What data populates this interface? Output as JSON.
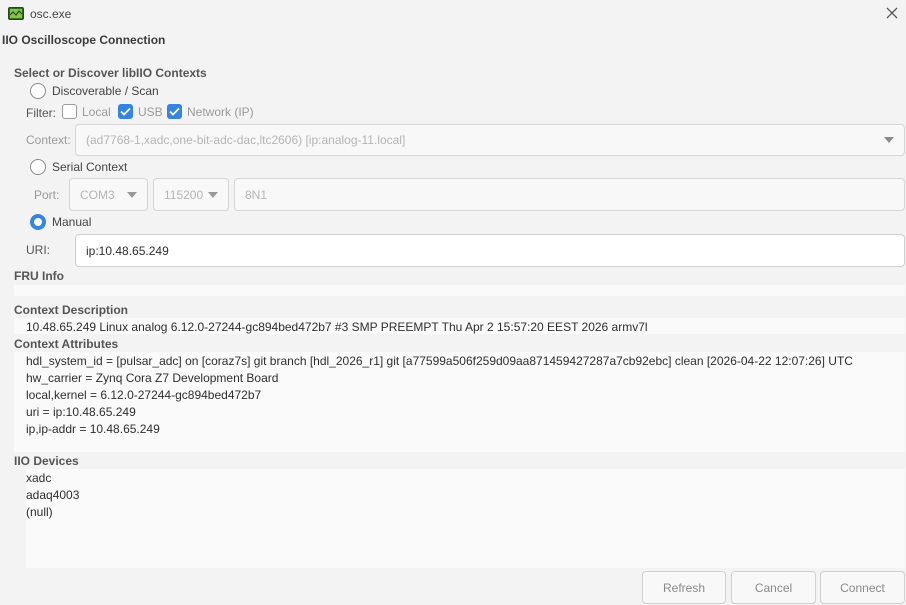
{
  "window": {
    "title": "osc.exe"
  },
  "dialog": {
    "title": "IIO Oscilloscope Connection"
  },
  "contexts": {
    "section_title": "Select or Discover libIIO Contexts",
    "discoverable_label": "Discoverable / Scan",
    "filter_label": "Filter:",
    "filter_local": "Local",
    "filter_usb": "USB",
    "filter_network": "Network (IP)",
    "context_label": "Context:",
    "context_value": "(ad7768-1,xadc,one-bit-adc-dac,ltc2606) [ip:analog-11.local]",
    "serial_label": "Serial Context",
    "port_label": "Port:",
    "port_value": "COM3",
    "baud_value": "115200",
    "serial_config": "8N1",
    "manual_label": "Manual",
    "uri_label": "URI:",
    "uri_value": "ip:10.48.65.249"
  },
  "fru": {
    "title": "FRU Info"
  },
  "description": {
    "title": "Context Description",
    "text": "10.48.65.249 Linux analog 6.12.0-27244-gc894bed472b7 #3 SMP PREEMPT Thu Apr  2 15:57:20 EEST 2026 armv7l"
  },
  "attributes": {
    "title": "Context Attributes",
    "lines": [
      "hdl_system_id = [pulsar_adc] on [coraz7s] git branch [hdl_2026_r1] git [a77599a506f259d09aa871459427287a7cb92ebc] clean [2026-04-22 12:07:26] UTC",
      "hw_carrier = Zynq Cora Z7 Development Board",
      "local,kernel = 6.12.0-27244-gc894bed472b7",
      "uri = ip:10.48.65.249",
      "ip,ip-addr = 10.48.65.249"
    ]
  },
  "devices": {
    "title": "IIO Devices",
    "items": [
      "xadc",
      "adaq4003",
      "(null)"
    ]
  },
  "buttons": {
    "refresh": "Refresh",
    "cancel": "Cancel",
    "connect": "Connect"
  },
  "colors": {
    "accent": "#3584e4",
    "background": "#f3f3f3",
    "panel": "#fafafa"
  }
}
